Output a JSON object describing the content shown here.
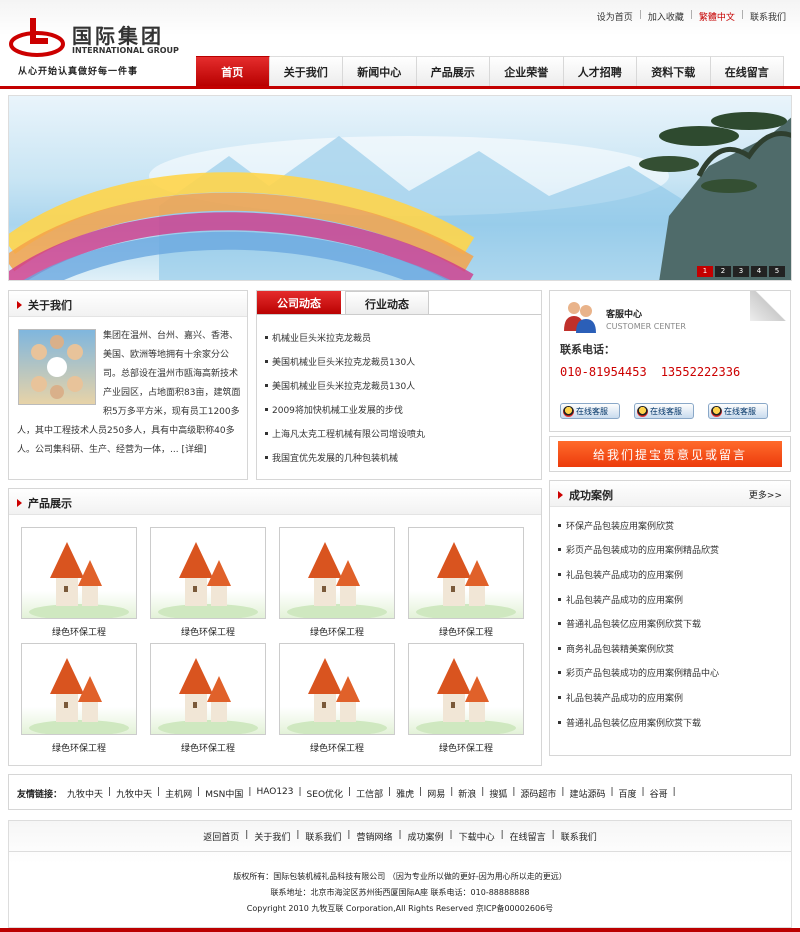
{
  "header": {
    "logo_cn": "国际集团",
    "logo_en": "INTERNATIONAL GROUP",
    "slogan": "从心开始认真做好每一件事",
    "toplinks": [
      "设为首页",
      "加入收藏",
      "繁體中文",
      "联系我们"
    ]
  },
  "nav": [
    "首页",
    "关于我们",
    "新闻中心",
    "产品展示",
    "企业荣誉",
    "人才招聘",
    "资料下载",
    "在线留言"
  ],
  "banner": {
    "dots": [
      "1",
      "2",
      "3",
      "4",
      "5"
    ]
  },
  "about": {
    "title": "关于我们",
    "text": "集团在温州、台州、嘉兴、香港、美国、欧洲等地拥有十余家分公司。总部设在温州市瓯海高新技术产业园区，占地面积83亩，建筑面积5万多平方米，现有员工1200多人，其中工程技术人员250多人，具有中高级职称40多人。公司集科研、生产、经营为一体，... [详细]"
  },
  "news": {
    "tabs": [
      "公司动态",
      "行业动态"
    ],
    "items": [
      "机械业巨头米拉克龙裁员",
      "美国机械业巨头米拉克龙裁员130人",
      "美国机械业巨头米拉克龙裁员130人",
      "2009将加快机械工业发展的步伐",
      "上海凡太克工程机械有限公司增设喷丸",
      "我国宜优先发展的几种包装机械"
    ]
  },
  "service": {
    "title": "客服中心",
    "subtitle": "CUSTOMER CENTER",
    "phone_label": "联系电话：",
    "phones": [
      "010-81954453",
      "13552222336"
    ],
    "qq_label": "在线客服",
    "qq_count": 3
  },
  "feedback": {
    "label": "给我们提宝贵意见或留言"
  },
  "products": {
    "title": "产品展示",
    "items": [
      "绿色环保工程",
      "绿色环保工程",
      "绿色环保工程",
      "绿色环保工程",
      "绿色环保工程",
      "绿色环保工程",
      "绿色环保工程",
      "绿色环保工程"
    ]
  },
  "cases": {
    "title": "成功案例",
    "more": "更多>>",
    "items": [
      "环保产品包装应用案例欣赏",
      "彩页产品包装成功的应用案例精品欣赏",
      "礼品包装产品成功的应用案例",
      "礼品包装产品成功的应用案例",
      "普通礼品包装亿应用案例欣赏下载",
      "商务礼品包装精美案例欣赏",
      "彩页产品包装成功的应用案例精品中心",
      "礼品包装产品成功的应用案例",
      "普通礼品包装亿应用案例欣赏下载"
    ]
  },
  "links": {
    "label": "友情链接：",
    "items": [
      "九牧中天",
      "九牧中天",
      "主机网",
      "MSN中国",
      "HAO123",
      "SEO优化",
      "工信部",
      "雅虎",
      "网易",
      "新浪",
      "搜狐",
      "源码超市",
      "建站源码",
      "百度",
      "谷哥"
    ]
  },
  "footer": {
    "nav": [
      "返回首页",
      "关于我们",
      "联系我们",
      "营销网络",
      "成功案例",
      "下载中心",
      "在线留言",
      "联系我们"
    ],
    "copyright_owner": "版权所有：国际包装机械礼品科技有限公司 （因为专业所以做的更好-因为用心所以走的更远）",
    "address": "联系地址：北京市海淀区苏州街西厦国际A座 联系电话：010-88888888",
    "copyright": "Copyright 2010 九牧互联 Corporation,All Rights Reserved 京ICP备00002606号"
  },
  "colors": {
    "brand_red": "#c30000",
    "accent_orange": "#ec3b0c"
  }
}
